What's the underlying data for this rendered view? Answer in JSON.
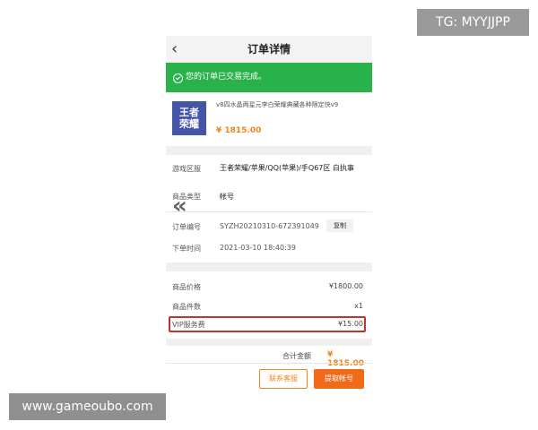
{
  "overlay": {
    "tg": "TG: MYYJJPP",
    "watermark": "www.gameoubo.com"
  },
  "header": {
    "back_icon": "‹",
    "title": "订单详情"
  },
  "status": {
    "text": "您的订单已交易完成。"
  },
  "product": {
    "logo_text": "王者荣耀",
    "name": "v8四水晶两星元李白荣耀典藏各种限定快v9",
    "price": "¥ 1815.00"
  },
  "info": {
    "region_label": "游戏区服",
    "region_value": "王者荣耀/苹果/QQ(苹果)/手Q67区 白执事",
    "type_label": "商品类型",
    "type_value": "帐号"
  },
  "order": {
    "number_label": "订单编号",
    "number_value": "SYZH20210310-672391049",
    "copy_label": "复制",
    "time_label": "下单时间",
    "time_value": "2021-03-10 18:40:39"
  },
  "fees": {
    "price_label": "商品价格",
    "price_value": "¥1800.00",
    "count_label": "商品件数",
    "count_value": "x1",
    "vip_label": "VIP服务费",
    "vip_value": "¥15.00"
  },
  "total": {
    "label": "合计金额",
    "value": "¥ 1815.00"
  },
  "actions": {
    "service": "联系客服",
    "withdraw": "提取帐号"
  },
  "colors": {
    "success": "#29b14a",
    "accent": "#f08519",
    "highlight": "#c9302c"
  }
}
